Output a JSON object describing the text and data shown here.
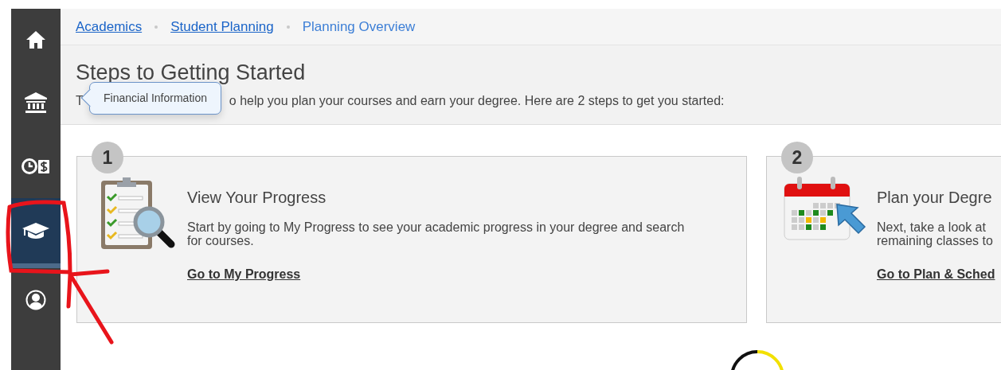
{
  "sidebar": {
    "items": [
      {
        "kind": "home",
        "selected": false
      },
      {
        "kind": "bank",
        "selected": false
      },
      {
        "kind": "finance",
        "selected": false
      },
      {
        "kind": "academics",
        "selected": true
      },
      {
        "kind": "user",
        "selected": false
      }
    ]
  },
  "breadcrumb": [
    {
      "label": "Academics",
      "kind": "link"
    },
    {
      "label": "Student Planning",
      "kind": "link"
    },
    {
      "label": "Planning Overview",
      "kind": "current"
    }
  ],
  "header": {
    "title": "Steps to Getting Started",
    "intro_start": "T",
    "intro_end": "o help you plan your courses and earn your degree. Here are 2 steps to get you started:"
  },
  "tooltip": {
    "text": "Financial Information"
  },
  "steps": [
    {
      "number": "1",
      "kind": "progress",
      "title": "View Your Progress",
      "description": [
        "Start by going to My Progress to see your academic progress in your degree and search",
        "for courses."
      ],
      "link": "Go to My Progress"
    },
    {
      "number": "2",
      "kind": "plan",
      "title": "Plan your Degre",
      "description": [
        "Next, take a look at",
        "remaining classes to"
      ],
      "link": "Go to Plan & Sched"
    }
  ],
  "loading": true
}
